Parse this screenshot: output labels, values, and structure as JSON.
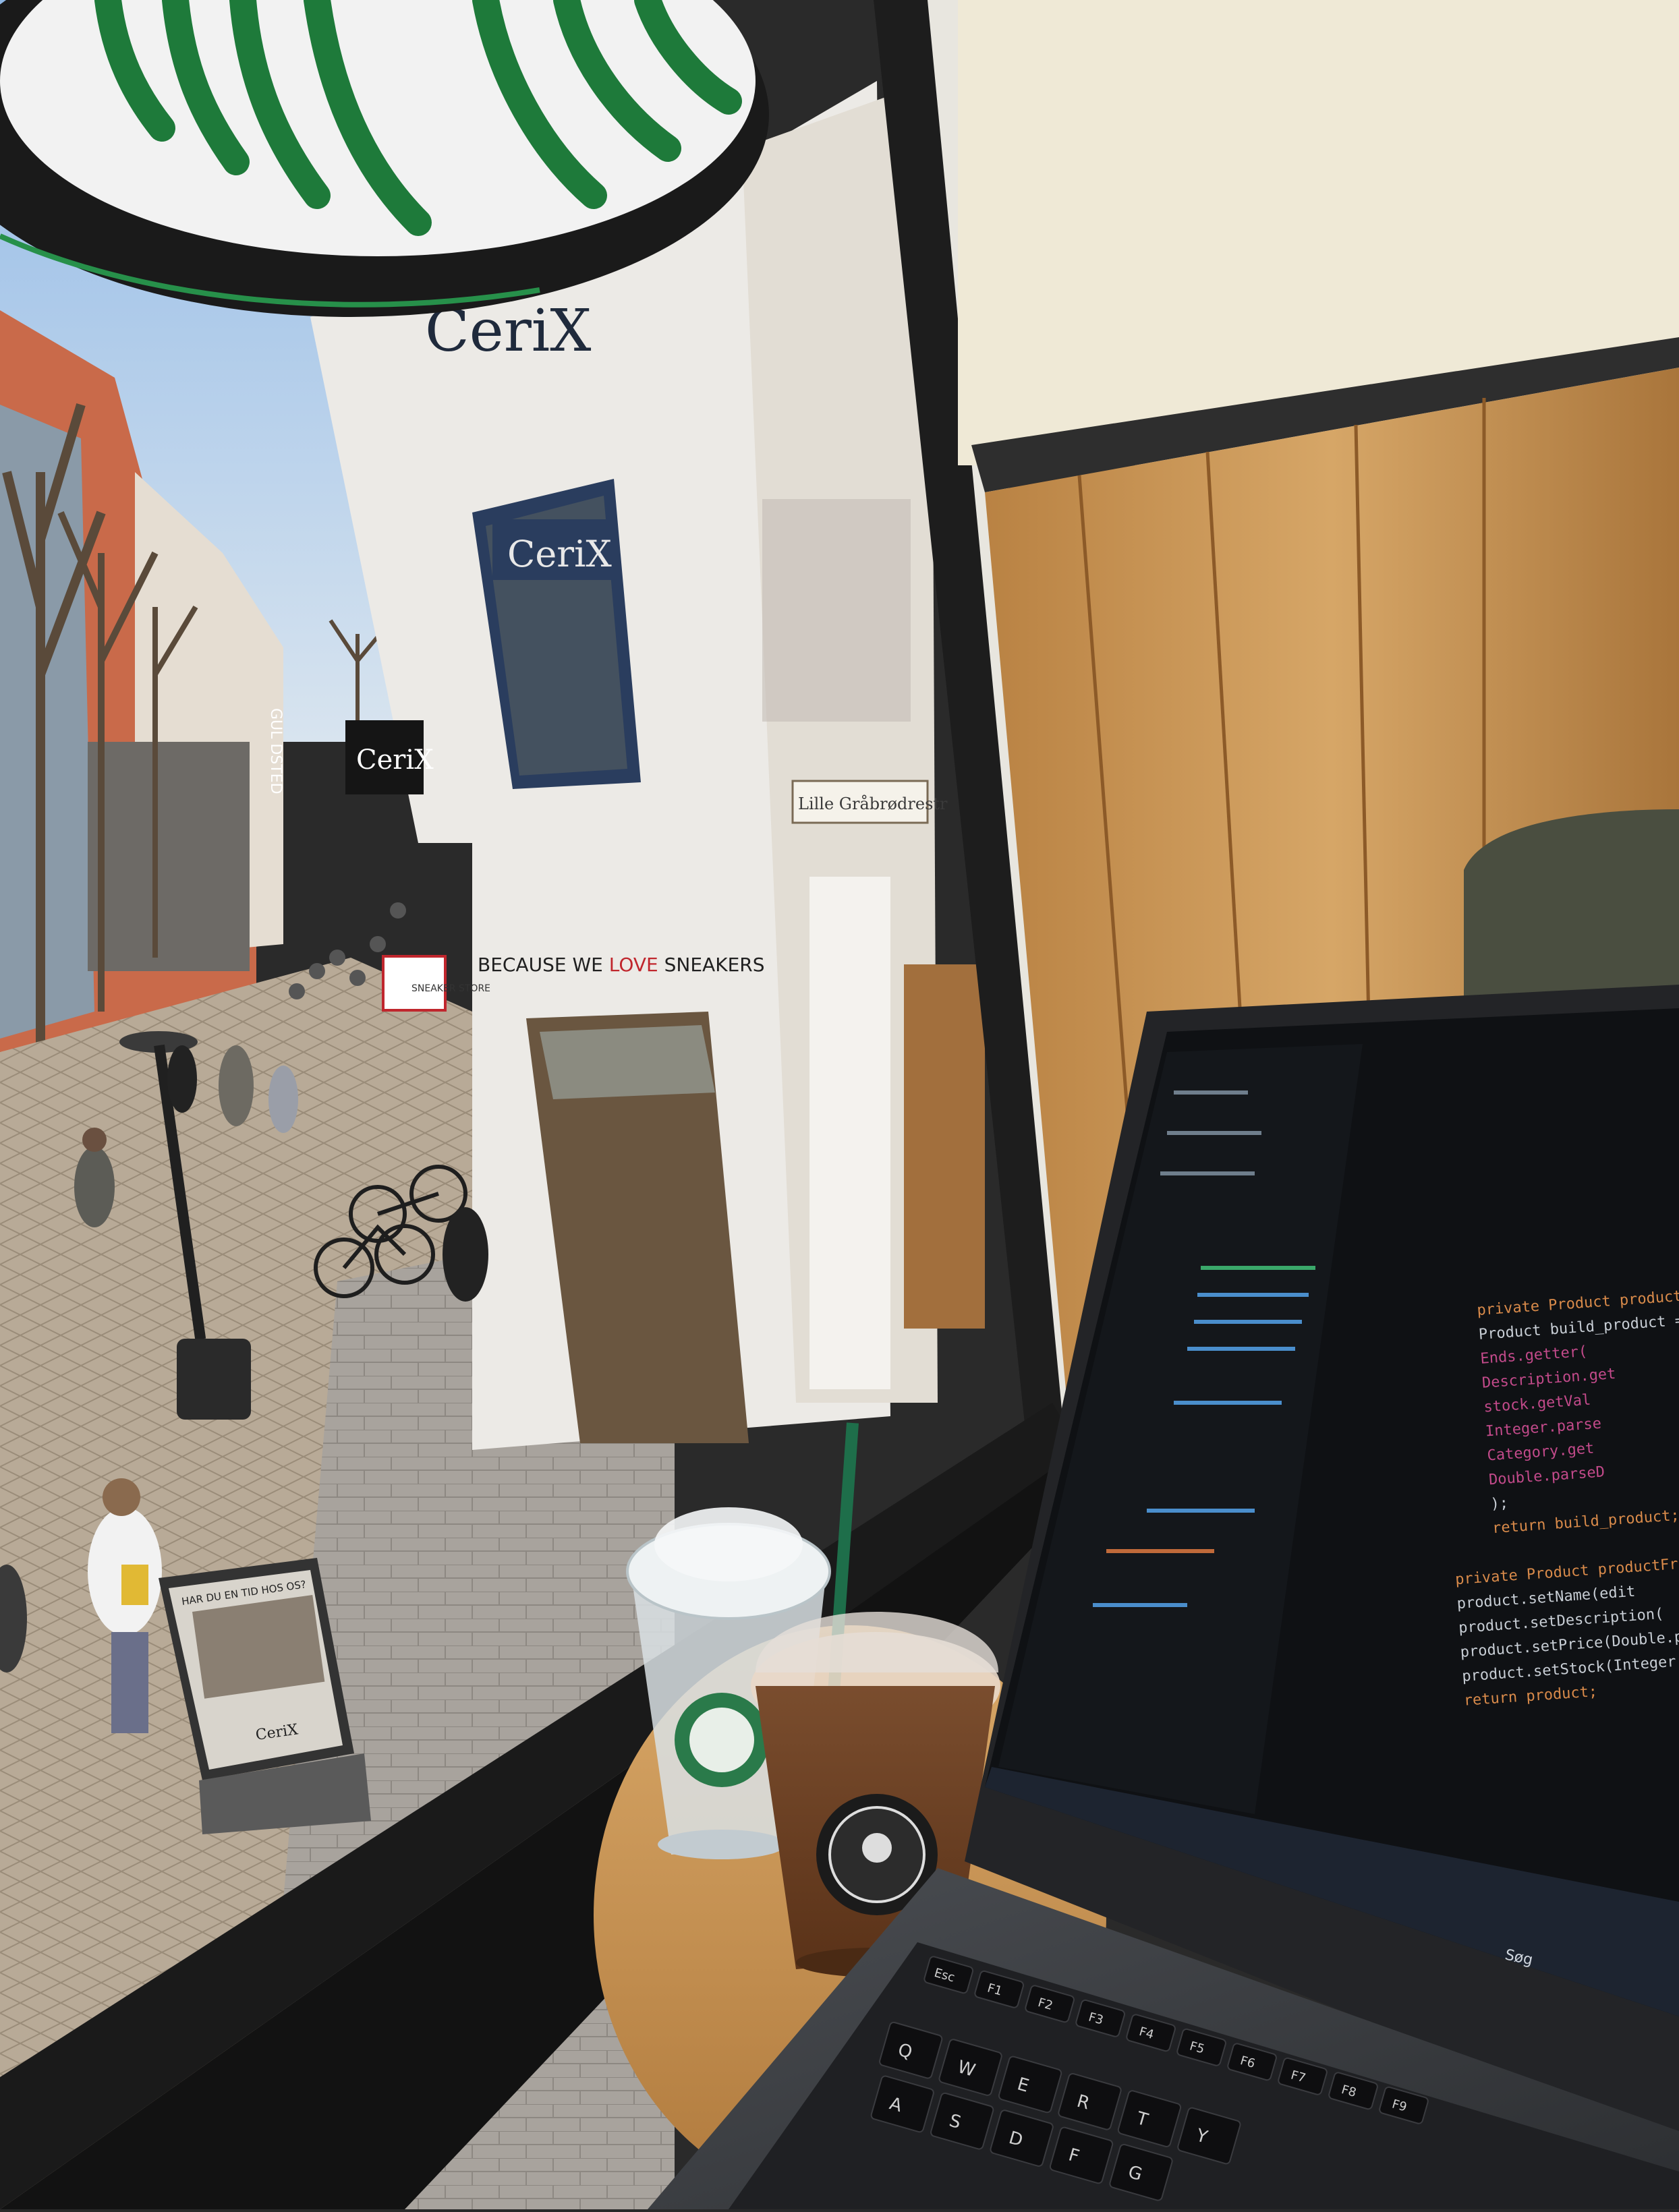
{
  "signs": {
    "cerix_top": "CeriX",
    "cerix_window": "CeriX",
    "cerix_far": "CeriX",
    "street_name": "Lille Gråbrødrestr",
    "sneakers_slogan_prefix": "BECAUSE WE ",
    "sneakers_slogan_love": "LOVE",
    "sneakers_slogan_suffix": " SNEAKERS",
    "shop_small": "SNEAKER STORE",
    "sandwich_board_heading": "HAR DU EN TID HOS OS?",
    "sandwich_board_brand": "CeriX",
    "vertical_sign": "GUL DSTED"
  },
  "laptop": {
    "code_lines": [
      "private Product productFromDto",
      "  Product build_product =",
      "    Ends.getter(",
      "    Description.get",
      "    stock.getVal",
      "    Integer.parse",
      "    Category.get",
      "    Double.parseD",
      "  );",
      "  return build_product;",
      "",
      "private Product productFromView(",
      "  product.setName(edit",
      "  product.setDescription(",
      "  product.setPrice(Double.pars",
      "  product.setStock(Integer.pars",
      "  return product;"
    ],
    "keys": [
      "Esc",
      "F1",
      "F2",
      "F3",
      "F4",
      "F5",
      "F6",
      "F7",
      "F8",
      "F9",
      "Q",
      "W",
      "E",
      "R",
      "T",
      "Y",
      "A",
      "S",
      "D",
      "F",
      "G"
    ],
    "taskbar_search": "Søg"
  },
  "colors": {
    "sky": "#a9c8e8",
    "starbucks_green": "#1e7a3a",
    "wood": "#c99657",
    "screen": "#0f1114"
  }
}
